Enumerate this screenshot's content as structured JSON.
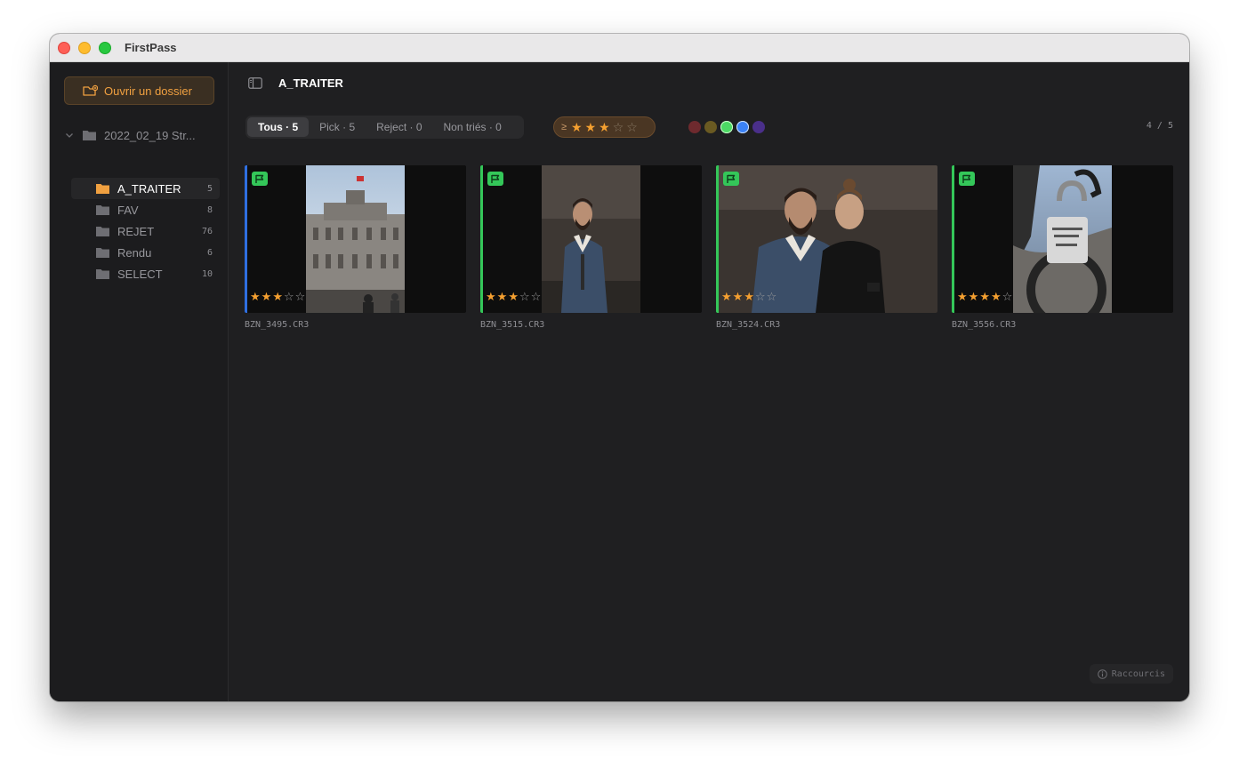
{
  "window": {
    "title": "FirstPass"
  },
  "sidebar": {
    "open_button_label": "Ouvrir un dossier",
    "root_folder": "2022_02_19 Str...",
    "folders": [
      {
        "label": "A_TRAITER",
        "count": "5",
        "active": true
      },
      {
        "label": "FAV",
        "count": "8",
        "active": false
      },
      {
        "label": "REJET",
        "count": "76",
        "active": false
      },
      {
        "label": "Rendu",
        "count": "6",
        "active": false
      },
      {
        "label": "SELECT",
        "count": "10",
        "active": false
      }
    ]
  },
  "header": {
    "folder_title": "A_TRAITER"
  },
  "filters": {
    "tabs": [
      {
        "label": "Tous · 5",
        "active": true
      },
      {
        "label": "Pick · 5",
        "active": false
      },
      {
        "label": "Reject · 0",
        "active": false
      },
      {
        "label": "Non triés · 0",
        "active": false
      }
    ],
    "rating_prefix": "≥",
    "min_rating": 3,
    "max_rating": 5,
    "color_labels": [
      "#6e2a2e",
      "#6a5a22",
      "#4cd964",
      "#3b82f6",
      "#4a2f8a"
    ],
    "page_indicator": "4 / 5"
  },
  "photos": [
    {
      "filename": "BZN_3495.CR3",
      "rating": 3,
      "accent": "#2f6fe0",
      "flag": "pick"
    },
    {
      "filename": "BZN_3515.CR3",
      "rating": 3,
      "accent": "#34c759",
      "flag": "pick"
    },
    {
      "filename": "BZN_3524.CR3",
      "rating": 3,
      "accent": "#34c759",
      "flag": "pick"
    },
    {
      "filename": "BZN_3556.CR3",
      "rating": 4,
      "accent": "#34c759",
      "flag": "pick"
    }
  ],
  "footer": {
    "shortcuts_label": "Raccourcis",
    "info_icon": "info-icon"
  },
  "colors": {
    "accent": "#f0a040",
    "pick": "#34c759"
  }
}
